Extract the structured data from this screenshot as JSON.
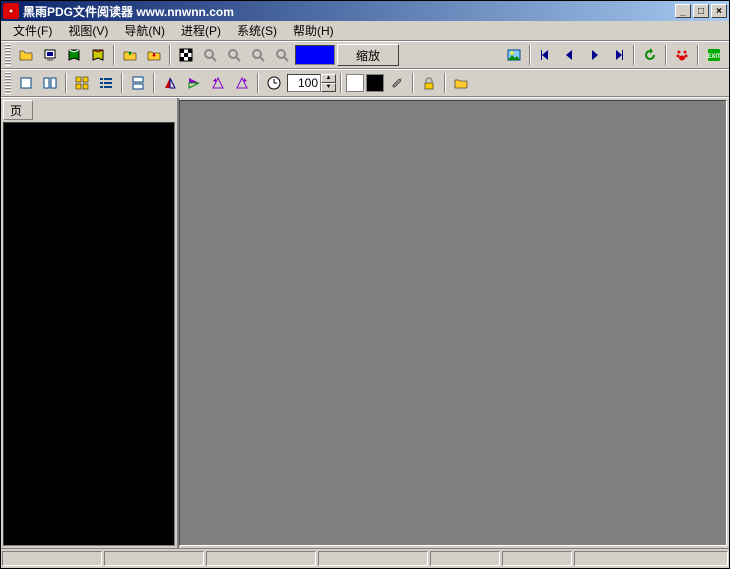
{
  "title": "黑雨PDG文件阅读器 www.nnwnn.com",
  "menu": {
    "file": "文件(F)",
    "view": "视图(V)",
    "nav": "导航(N)",
    "process": "进程(P)",
    "system": "系统(S)",
    "help": "帮助(H)"
  },
  "toolbar1": {
    "zoom_label": "缩放",
    "color_value": "#0000ff"
  },
  "toolbar2": {
    "page_value": "100",
    "swatch1": "#ffffff",
    "swatch2": "#000000"
  },
  "sidebar": {
    "tab_label": "页"
  },
  "icons": {
    "open": "open-icon",
    "computer": "computer-icon",
    "book1": "book-green-icon",
    "book2": "book-yellow-icon",
    "folder_up": "folder-up-icon",
    "folder_in": "folder-in-icon",
    "checker": "checker-icon",
    "zoom_in": "zoom-in-icon",
    "zoom_out": "zoom-out-icon",
    "zoom_fit": "zoom-fit-icon",
    "zoom_actual": "zoom-actual-icon",
    "picture": "picture-icon",
    "first": "first-page-icon",
    "prev": "prev-page-icon",
    "next": "next-page-icon",
    "last": "last-page-icon",
    "refresh": "refresh-icon",
    "paw": "paw-icon",
    "exit": "exit-icon",
    "layout1": "layout-single-icon",
    "layout2": "layout-double-icon",
    "layout3": "layout-grid-icon",
    "layout4": "layout-list-icon",
    "flip_h": "flip-h-icon",
    "flip_v": "flip-v-icon",
    "rotate_l": "rotate-left-icon",
    "rotate_r": "rotate-right-icon",
    "clock": "clock-icon",
    "dropper": "dropper-icon",
    "lock": "lock-icon",
    "folder": "folder-icon"
  }
}
